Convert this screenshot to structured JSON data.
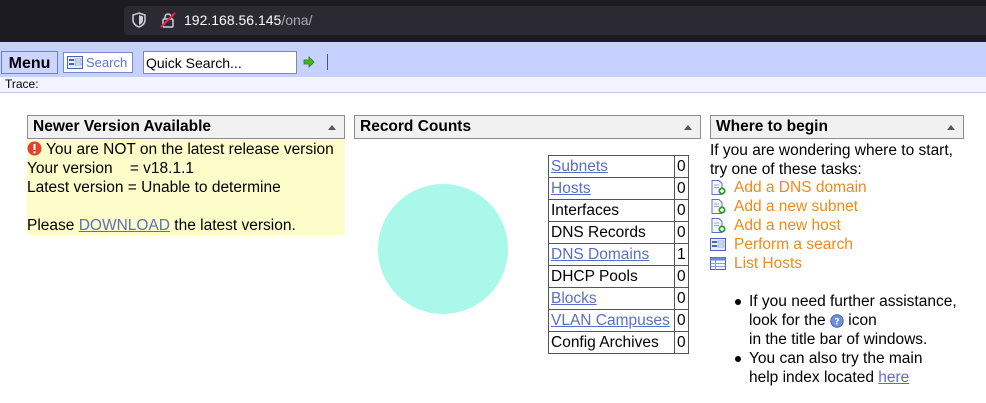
{
  "browser": {
    "url_host": "192.168.56.145",
    "url_path": "/ona/"
  },
  "toolbar": {
    "menu_label": "Menu",
    "search_label": "Search",
    "quick_search_value": "Quick Search...",
    "trace_label": "Trace:"
  },
  "version_panel": {
    "title": "Newer Version Available",
    "warning": "You are NOT on the latest release version",
    "your_version": "Your version    = v18.1.1",
    "latest_version": "Latest version = Unable to determine",
    "please": "Please ",
    "download_link": "DOWNLOAD",
    "after_link": " the latest version."
  },
  "records_panel": {
    "title": "Record Counts",
    "pie_color": "#aaf8ea",
    "rows": [
      {
        "label": "Subnets",
        "count": "0",
        "link": true
      },
      {
        "label": "Hosts",
        "count": "0",
        "link": true
      },
      {
        "label": "Interfaces",
        "count": "0",
        "link": false
      },
      {
        "label": "DNS Records",
        "count": "0",
        "link": false
      },
      {
        "label": "DNS Domains",
        "count": "1",
        "link": true
      },
      {
        "label": "DHCP Pools",
        "count": "0",
        "link": false
      },
      {
        "label": "Blocks",
        "count": "0",
        "link": true
      },
      {
        "label": "VLAN Campuses",
        "count": "0",
        "link": true
      },
      {
        "label": "Config Archives",
        "count": "0",
        "link": false
      }
    ]
  },
  "begin_panel": {
    "title": "Where to begin",
    "intro_1": "If you are wondering where to start,",
    "intro_2": "try one of these tasks:",
    "tasks": [
      {
        "label": "Add a DNS domain",
        "icon": "add-page-icon"
      },
      {
        "label": "Add a new subnet",
        "icon": "add-page-icon"
      },
      {
        "label": "Add a new host",
        "icon": "add-page-icon"
      },
      {
        "label": "Perform a search",
        "icon": "search-form-icon"
      },
      {
        "label": "List Hosts",
        "icon": "list-table-icon"
      }
    ],
    "help_1": "If you need further assistance,",
    "help_2a": "look for the ",
    "help_2b": " icon",
    "help_3": "in the title bar of windows.",
    "help_4": "You can also try the main",
    "help_5": "help index located ",
    "help_link": "here"
  },
  "colors": {
    "toolbar_bg": "#c7d1ff",
    "version_bg": "#fdfdc9",
    "link": "#5b6fc2",
    "task_link": "#ef8a1a"
  }
}
